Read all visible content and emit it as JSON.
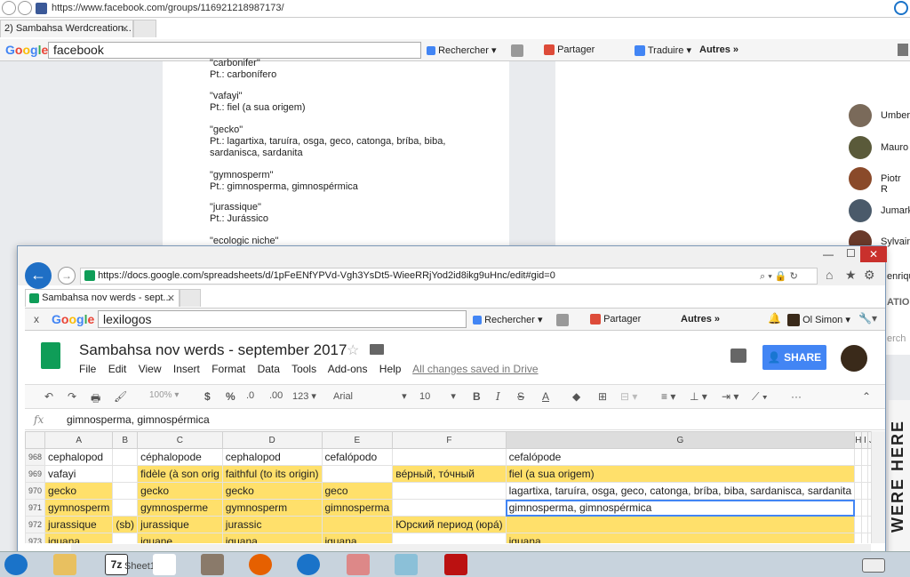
{
  "bg_browser": {
    "url": "https://www.facebook.com/groups/116921218987173/",
    "tab_title": "2) Sambahsa Werdcreation...",
    "google_search": "facebook",
    "toolbar": {
      "search": "Rechercher",
      "share": "Partager",
      "translate": "Traduire",
      "more": "Autres »"
    }
  },
  "fb_post": {
    "lines": [
      {
        "word": "\"carbonifer\"",
        "pt": "Pt.: carbonífero"
      },
      {
        "word": "\"vafayi\"",
        "pt": "Pt.: fiel (a sua origem)"
      },
      {
        "word": "\"gecko\"",
        "pt": "Pt.: lagartixa, taruíra, osga, geco, catonga, bríba, biba, sardanisca, sardanita"
      },
      {
        "word": "\"gymnosperm\"",
        "pt": "Pt.: gimnosperma, gimnospérmica"
      },
      {
        "word": "\"jurassique\"",
        "pt": "Pt.: Jurássico"
      },
      {
        "word": "\"ecologic niche\"",
        "pt": ""
      }
    ]
  },
  "contacts": [
    "Umber",
    "Mauro",
    "Piotr R",
    "Jumark",
    "Sylvain",
    "enriqu"
  ],
  "contacts_extra": {
    "label": "ATIO",
    "search_stub": "erch"
  },
  "fg_browser": {
    "url": "https://docs.google.com/spreadsheets/d/1pFeENfYPVd-Vgh3YsDt5-WieeRRjYod2id8ikg9uHnc/edit#gid=0",
    "tab_title": "Sambahsa nov werds - sept...",
    "google_search": "lexilogos",
    "toolbar": {
      "search": "Rechercher",
      "share": "Partager",
      "more": "Autres »",
      "user": "Ol Simon"
    }
  },
  "sheet": {
    "title": "Sambahsa nov werds - september 2017",
    "menu": [
      "File",
      "Edit",
      "View",
      "Insert",
      "Format",
      "Data",
      "Tools",
      "Add-ons",
      "Help"
    ],
    "saved_status": "All changes saved in Drive",
    "share_label": "SHARE",
    "toolbar": {
      "zoom": "100%",
      "currency": "$",
      "percent": "%",
      "dec_less": ".0",
      "dec_more": ".00",
      "number_format": "123",
      "font": "Arial",
      "font_size": "10"
    },
    "formula_label": "fx",
    "formula_value": "gimnosperma, gimnospérmica",
    "columns": [
      "A",
      "B",
      "C",
      "D",
      "E",
      "F",
      "G",
      "H",
      "I",
      "J"
    ],
    "rows": [
      {
        "num": "968",
        "cells": [
          "cephalopod",
          "",
          "céphalopode",
          "cephalopod",
          "cefalópodo",
          "",
          "cefalópode",
          "",
          "",
          ""
        ],
        "yellow": []
      },
      {
        "num": "969",
        "cells": [
          "vafayi",
          "",
          "fidèle (à son orig",
          "faithful (to its origin)",
          "",
          "вéрный, тóчный",
          "fiel (a sua origem)",
          "",
          "",
          ""
        ],
        "yellow": [
          2,
          3,
          5,
          6
        ]
      },
      {
        "num": "970",
        "cells": [
          "gecko",
          "",
          "gecko",
          "gecko",
          "geco",
          "",
          "lagartixa, taruíra, osga, geco, catonga, bríba, biba, sardanisca, sardanita",
          "",
          "",
          ""
        ],
        "yellow": [
          0,
          2,
          3,
          4
        ]
      },
      {
        "num": "971",
        "cells": [
          "gymnosperm",
          "",
          "gymnosperme",
          "gymnosperm",
          "gimnosperma",
          "",
          "gimnosperma, gimnospérmica",
          "",
          "",
          ""
        ],
        "yellow": [
          0,
          2,
          3,
          4
        ]
      },
      {
        "num": "972",
        "cells": [
          "jurassique",
          "(sb)",
          "jurassique",
          "jurassic",
          "",
          "Юрский период (юрá)",
          "",
          "",
          "",
          ""
        ],
        "yellow": [
          0,
          1,
          2,
          3,
          4,
          5,
          6
        ]
      },
      {
        "num": "973",
        "cells": [
          "iguana",
          "",
          "iguane",
          "iguana",
          "iguana",
          "",
          "iguana",
          "",
          "",
          ""
        ],
        "yellow": [
          0,
          2,
          3,
          4,
          6
        ]
      }
    ],
    "sheet_tab": "Sheet1"
  },
  "taskbar": {
    "app_7z": "7z"
  },
  "side_banner": "WERE HERE"
}
